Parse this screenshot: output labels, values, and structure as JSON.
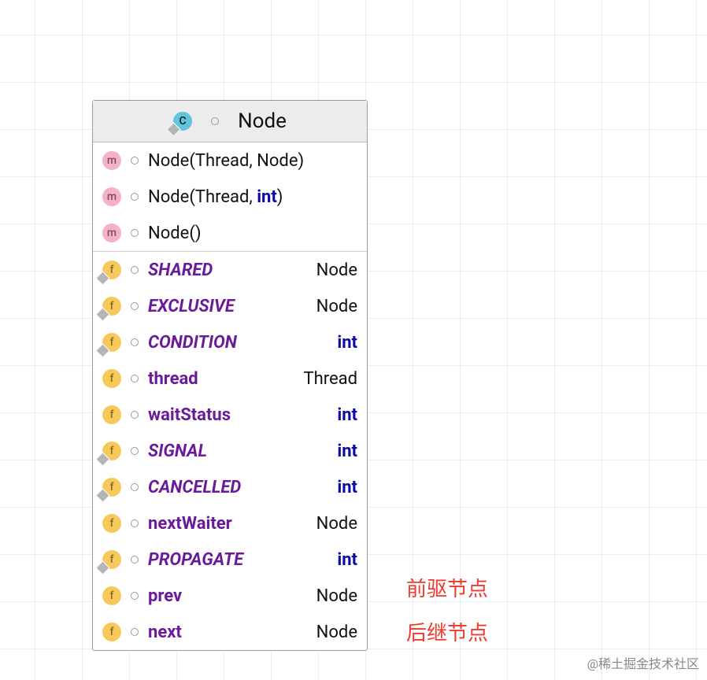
{
  "header": {
    "class_name": "Node"
  },
  "methods": [
    {
      "label_pre": "Node",
      "paren_open": "(",
      "args": "Thread, Node",
      "paren_close": ")"
    },
    {
      "label_pre": "Node",
      "paren_open": "(",
      "args_pre": "Thread, ",
      "kw": "int",
      "paren_close": ")"
    },
    {
      "label_pre": "Node",
      "paren_open": "(",
      "args": "",
      "paren_close": ")"
    }
  ],
  "fields": [
    {
      "name": "SHARED",
      "static": true,
      "rtype": "Node",
      "rtype_kw": false
    },
    {
      "name": "EXCLUSIVE",
      "static": true,
      "rtype": "Node",
      "rtype_kw": false
    },
    {
      "name": "CONDITION",
      "static": true,
      "rtype": "int",
      "rtype_kw": true
    },
    {
      "name": "thread",
      "static": false,
      "rtype": "Thread",
      "rtype_kw": false
    },
    {
      "name": "waitStatus",
      "static": false,
      "rtype": "int",
      "rtype_kw": true
    },
    {
      "name": "SIGNAL",
      "static": true,
      "rtype": "int",
      "rtype_kw": true
    },
    {
      "name": "CANCELLED",
      "static": true,
      "rtype": "int",
      "rtype_kw": true
    },
    {
      "name": "nextWaiter",
      "static": false,
      "rtype": "Node",
      "rtype_kw": false
    },
    {
      "name": "PROPAGATE",
      "static": true,
      "rtype": "int",
      "rtype_kw": true
    },
    {
      "name": "prev",
      "static": false,
      "rtype": "Node",
      "rtype_kw": false
    },
    {
      "name": "next",
      "static": false,
      "rtype": "Node",
      "rtype_kw": false
    }
  ],
  "annotations": {
    "prev": "前驱节点",
    "next": "后继节点"
  },
  "watermark": "@稀土掘金技术社区"
}
